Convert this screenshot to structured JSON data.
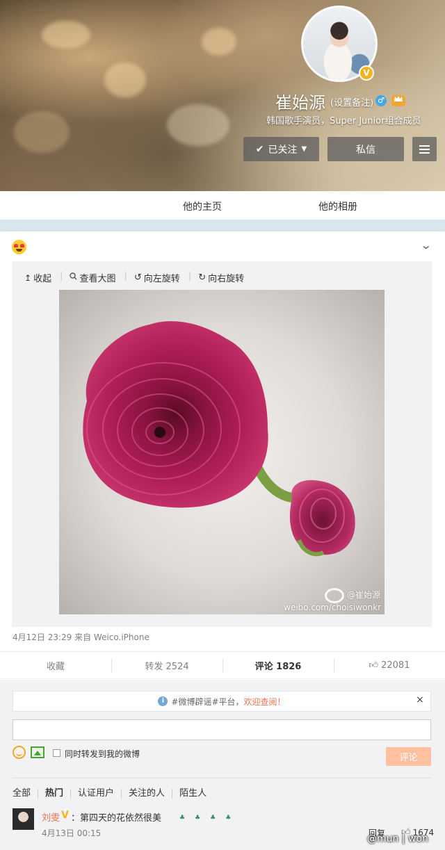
{
  "profile": {
    "name": "崔始源",
    "remark": "(设置备注)",
    "intro": "韩国歌手演员，Super Junior组合成员",
    "follow_label": "已关注",
    "message_label": "私信",
    "verified_mark": "V",
    "gender_mark": "♂"
  },
  "tabs": [
    "他的主页",
    "他的相册"
  ],
  "post": {
    "media_tools": [
      "收起",
      "查看大图",
      "向左旋转",
      "向右旋转"
    ],
    "watermark_name": "@崔始源",
    "watermark_url": "weibo.com/choisiwonkr",
    "meta": "4月12日 23:29 来自 Weico.iPhone"
  },
  "actions": {
    "favorite": "收藏",
    "repost": "转发 2524",
    "comment": "评论 1826",
    "like": "22081"
  },
  "comment_box": {
    "notice_text": "#微博辟谣#平台，",
    "notice_link": "欢迎查阅！",
    "close": "×",
    "repost_label": "同时转发到我的微博",
    "submit_label": "评论"
  },
  "filters": [
    "全部",
    "热门",
    "认证用户",
    "关注的人",
    "陌生人"
  ],
  "comments": [
    {
      "user": "刘雯",
      "verified": "V",
      "text": "：第四天的花依然很美",
      "time": "4月13日 00:15",
      "reply_label": "回复",
      "likes": "1674"
    }
  ],
  "credit": "@mun | won",
  "colors": {
    "accent": "#eb7350",
    "rose": "#a8174a"
  }
}
